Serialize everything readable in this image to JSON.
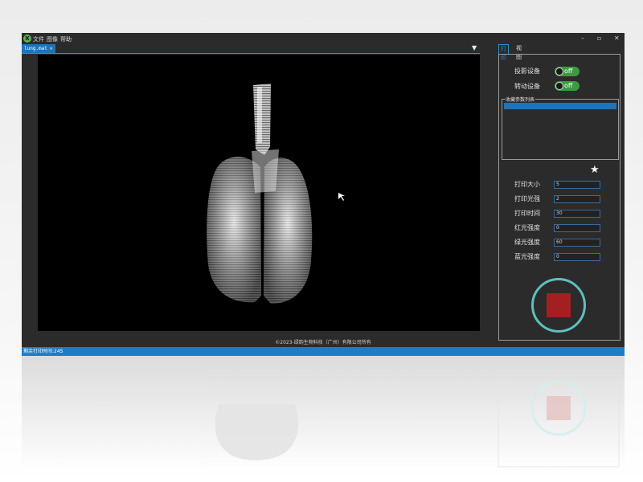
{
  "app": {
    "icon_letter": "X"
  },
  "menu": {
    "items": [
      "文件",
      "图像",
      "帮助"
    ]
  },
  "window_controls": {
    "minimize": "–",
    "maximize": "▫",
    "close": "✕"
  },
  "document_tab": {
    "label": "lung.mat",
    "close": "✕"
  },
  "viewer": {
    "dropdown": "▼"
  },
  "right_panel": {
    "tabs": [
      "打印",
      "视图"
    ],
    "toggles": [
      {
        "label": "投影设备",
        "value": "off"
      },
      {
        "label": "转动设备",
        "value": "off"
      }
    ],
    "favorites_title": "收藏参数列表",
    "star": "★",
    "params": [
      {
        "label": "打印大小",
        "value": "5"
      },
      {
        "label": "打印光强",
        "value": "2"
      },
      {
        "label": "打印时间",
        "value": "30"
      },
      {
        "label": "红光强度",
        "value": "0"
      },
      {
        "label": "绿光强度",
        "value": "60"
      },
      {
        "label": "蓝光强度",
        "value": "0"
      }
    ]
  },
  "footer": {
    "copyright": "©2023-绿韵生物科技（广州）有限公司所有"
  },
  "status": {
    "remaining": "剩余打印时间:24S"
  },
  "colors": {
    "accent": "#1f74b7",
    "toggle_on": "#3a9c3d",
    "stop_ring": "#5fbfbd",
    "stop_square": "#a41f22"
  }
}
